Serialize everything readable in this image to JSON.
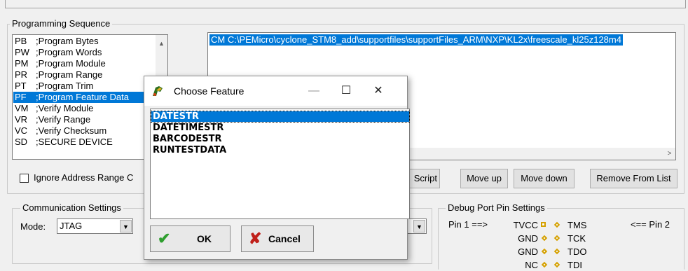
{
  "programming_sequence": {
    "title": "Programming Sequence",
    "commands": [
      {
        "code": "PB",
        "label": ";Program Bytes"
      },
      {
        "code": "PW",
        "label": ";Program Words"
      },
      {
        "code": "PM",
        "label": ";Program Module"
      },
      {
        "code": "PR",
        "label": ";Program Range"
      },
      {
        "code": "PT",
        "label": ";Program Trim"
      },
      {
        "code": "PF",
        "label": ";Program Feature Data"
      },
      {
        "code": "VM",
        "label": ";Verify Module"
      },
      {
        "code": "VR",
        "label": ";Verify Range"
      },
      {
        "code": "VC",
        "label": ";Verify Checksum"
      },
      {
        "code": "SD",
        "label": ";SECURE DEVICE"
      }
    ],
    "selected_command": "PF",
    "script_line": "CM  C:\\PEMicro\\cyclone_STM8_add\\supportfiles\\supportFiles_ARM\\NXP\\KL2x\\freescale_kl25z128m4",
    "ignore_address_label": "Ignore Address Range C",
    "ignore_address_checked": false,
    "buttons": {
      "script": "Script",
      "move_up": "Move up",
      "move_down": "Move down",
      "remove": "Remove From List"
    }
  },
  "communication": {
    "title": "Communication Settings",
    "mode_label": "Mode:",
    "mode_value": "JTAG"
  },
  "debug_port": {
    "title": "Debug Port Pin Settings",
    "pin1": "Pin 1 ==>",
    "pin2": "<== Pin 2",
    "rows": [
      {
        "left": "TVCC",
        "right": "TMS"
      },
      {
        "left": "GND",
        "right": "TCK"
      },
      {
        "left": "GND",
        "right": "TDO"
      },
      {
        "left": "NC",
        "right": "TDI"
      }
    ]
  },
  "dialog": {
    "title": "Choose Feature",
    "features": [
      "DATESTR",
      "DATETIMESTR",
      "BARCODESTR",
      "RUNTESTDATA"
    ],
    "selected": "DATESTR",
    "ok": "OK",
    "cancel": "Cancel",
    "minimize_glyph": "—",
    "maximize_glyph": "☐",
    "close_glyph": "✕"
  },
  "colors": {
    "selection": "#0078d7",
    "pin_marker": "#d4a000",
    "ok_icon": "#2e9e2e",
    "cancel_icon": "#c0201a"
  }
}
